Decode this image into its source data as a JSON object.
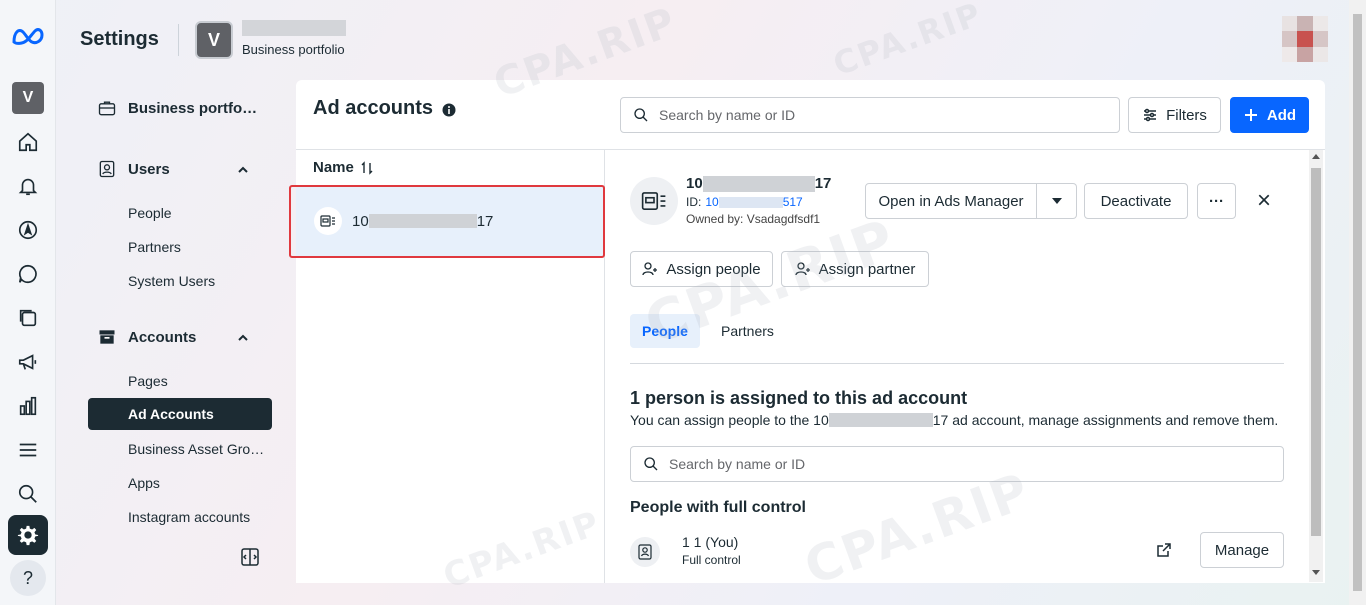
{
  "app": {
    "title": "Settings",
    "portfolio_initial": "V",
    "portfolio_subtitle": "Business portfolio"
  },
  "rail": {
    "avatar_initial": "V",
    "help_label": "?",
    "icons": [
      "meta-logo-icon",
      "home-icon",
      "notifications-icon",
      "navigation-icon",
      "messages-icon",
      "pages-icon",
      "megaphone-icon",
      "analytics-icon",
      "menu-icon",
      "search-icon",
      "settings-icon",
      "help-icon"
    ]
  },
  "nav": {
    "business_portfolio": "Business portfo…",
    "users": {
      "label": "Users",
      "items": [
        "People",
        "Partners",
        "System Users"
      ]
    },
    "accounts": {
      "label": "Accounts",
      "items": [
        "Pages",
        "Ad Accounts",
        "Business Asset Gro…",
        "Apps",
        "Instagram accounts"
      ],
      "active": "Ad Accounts"
    }
  },
  "panel": {
    "title": "Ad accounts",
    "search_placeholder": "Search by name or ID",
    "filters_label": "Filters",
    "add_label": "Add"
  },
  "list": {
    "column_header": "Name",
    "rows": [
      {
        "prefix": "10",
        "suffix": "17"
      }
    ]
  },
  "detail": {
    "name_prefix": "10",
    "name_suffix": "17",
    "id_label": "ID:",
    "id_prefix": "10",
    "id_suffix": "517",
    "owner": "Owned by: Vsadagdfsdf1",
    "open_ads_manager": "Open in Ads Manager",
    "deactivate": "Deactivate",
    "more": "···",
    "close": "×",
    "assign_people": "Assign people",
    "assign_partner": "Assign partner",
    "tabs": [
      "People",
      "Partners"
    ],
    "assigned_title": "1 person is assigned to this ad account",
    "assigned_desc_prefix": "You can assign people to the 10",
    "assigned_desc_suffix": "17 ad account, manage assignments and remove them.",
    "search_placeholder": "Search by name or ID",
    "section_title": "People with full control",
    "person": {
      "name": "1 1 (You)",
      "role": "Full control",
      "manage": "Manage"
    }
  },
  "watermark": "CPA.RIP",
  "colors": {
    "accent": "#0866ff",
    "dark": "#1c2b33",
    "highlight": "#e0393e",
    "selected_row": "#e7f0fb"
  }
}
